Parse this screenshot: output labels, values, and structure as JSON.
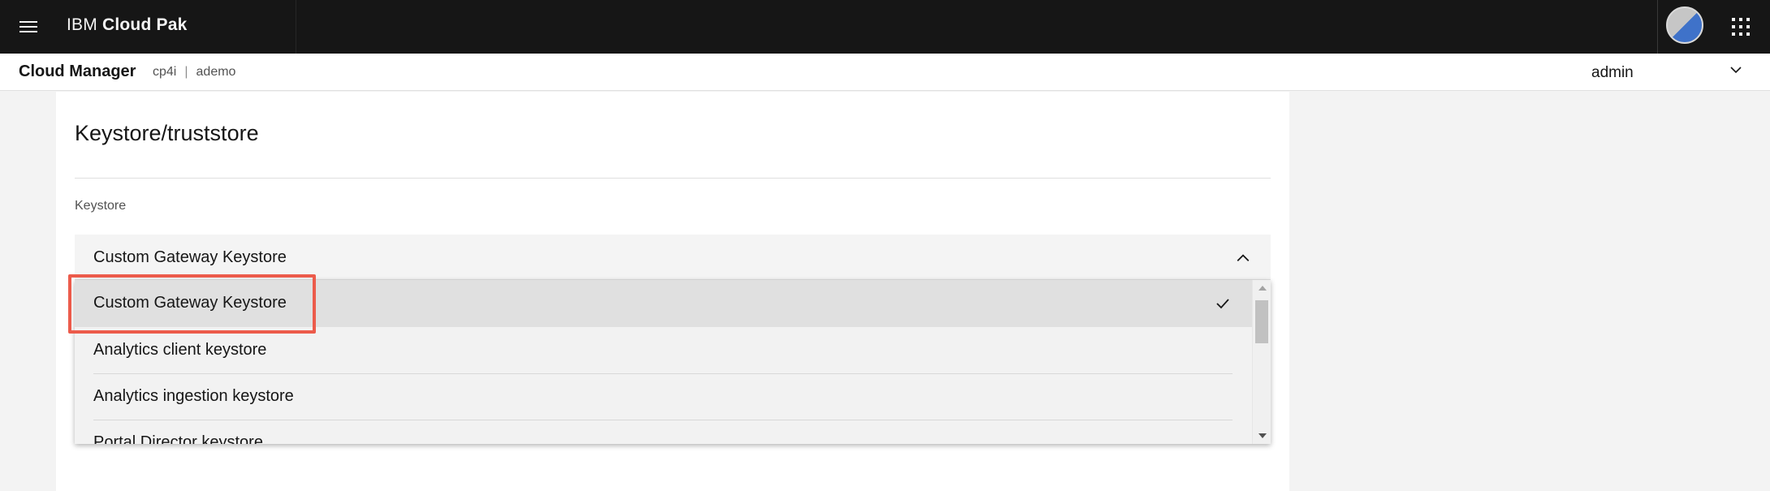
{
  "header": {
    "product_prefix": "IBM",
    "product_name": "Cloud Pak"
  },
  "subheader": {
    "title": "Cloud Manager",
    "breadcrumb": [
      "cp4i",
      "ademo"
    ],
    "breadcrumb_separator": "|",
    "user": "admin"
  },
  "panel": {
    "title": "Keystore/truststore",
    "field_label": "Keystore",
    "selected_value": "Custom Gateway Keystore",
    "options": [
      {
        "label": "Custom Gateway Keystore",
        "selected": true
      },
      {
        "label": "Analytics client keystore",
        "selected": false
      },
      {
        "label": "Analytics ingestion keystore",
        "selected": false
      },
      {
        "label": "Portal Director keystore",
        "selected": false
      }
    ]
  },
  "icons": {
    "menu": "hamburger-menu-icon",
    "avatar": "user-avatar",
    "apps": "app-switcher-icon",
    "user_dropdown": "chevron-down-icon",
    "select_open": "chevron-up-icon",
    "selected_mark": "checkmark-icon"
  },
  "colors": {
    "header_bg": "#161616",
    "highlight": "#ec5b4b",
    "avatar_blue": "#3f72c9"
  }
}
